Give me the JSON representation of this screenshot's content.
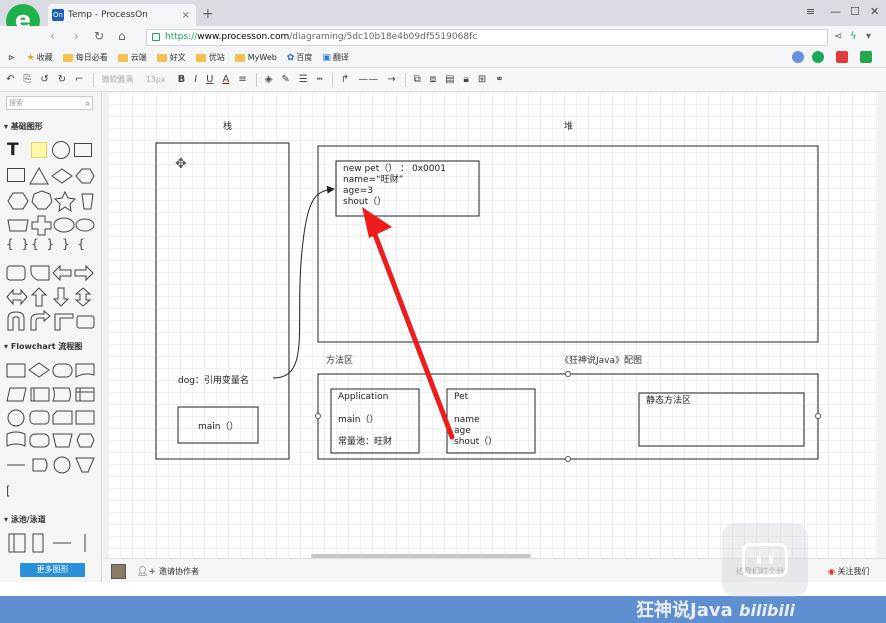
{
  "browser": {
    "tab_title": "Temp - ProcessOn",
    "tab_favicon": "On",
    "url_protocol": "https://",
    "url_host": "www.processon.com",
    "url_path": "/diagraming/5dc10b18e4b09df5519068fc",
    "logo": "e",
    "new_tab": "+",
    "close_tab": "×"
  },
  "bookmarks": [
    {
      "label": "收藏",
      "icon": "star-icon"
    },
    {
      "label": "每日必看",
      "icon": "folder-icon"
    },
    {
      "label": "云端",
      "icon": "folder-icon"
    },
    {
      "label": "好文",
      "icon": "folder-icon"
    },
    {
      "label": "优站",
      "icon": "folder-icon"
    },
    {
      "label": "MyWeb",
      "icon": "folder-icon"
    },
    {
      "label": "百度",
      "icon": "baidu-icon"
    },
    {
      "label": "翻译",
      "icon": "translate-icon"
    }
  ],
  "toolbar": {
    "font_name": "微软雅黑",
    "font_size": "13px",
    "bold": "B",
    "italic": "I",
    "underline": "U",
    "font_color": "A"
  },
  "sidebar": {
    "search_placeholder": "搜索",
    "sections": [
      {
        "title": "基础图形"
      },
      {
        "title": "Flowchart 流程图"
      },
      {
        "title": "泳池/泳道"
      }
    ],
    "text_tool": "T",
    "brace_glyphs": "{ }{ }  }  {",
    "bracket_glyph": "[",
    "more_button": "更多图形"
  },
  "diagram": {
    "stack_label": "栈",
    "heap_label": "堆",
    "method_area_label": "方法区",
    "caption": "《狂神说Java》配图",
    "heap_object": {
      "line1": "new pet（）  ：  0x0001",
      "line2": "name=“旺财”",
      "line3": "age=3",
      "line4": "shout（）"
    },
    "stack_var": "dog：引用变量名",
    "stack_main": "main（）",
    "application_class": {
      "title": "Application",
      "method": "main（）",
      "pool": "常量池：旺财"
    },
    "pet_class": {
      "title": "Pet",
      "field1": "name",
      "field2": "age",
      "method": "shout（）"
    },
    "static_area": "静态方法区"
  },
  "bottombar": {
    "invite_label": "邀请协作者",
    "rating_label": "给我们打个分?",
    "follow_label": "关注我们"
  },
  "watermark": {
    "text": "狂神说Java",
    "brand": "bilibili"
  },
  "colors": {
    "accent_green": "#20b24a",
    "more_button_blue": "#2a90d9",
    "arrow_red": "#ee1c1c"
  }
}
